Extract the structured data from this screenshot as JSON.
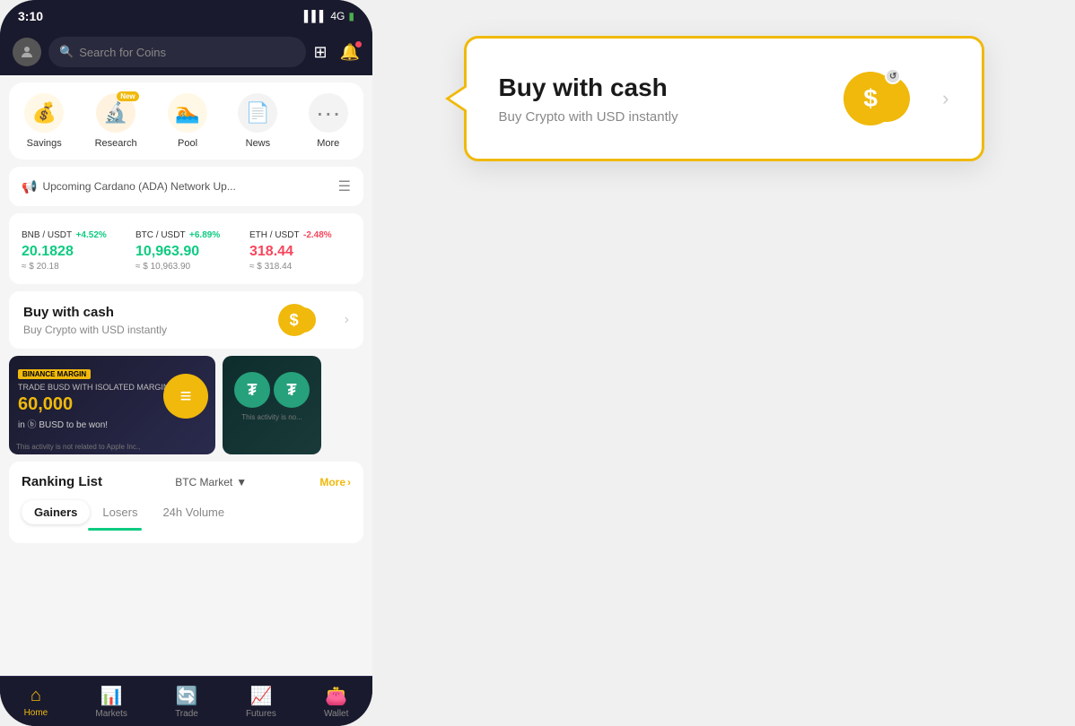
{
  "status_bar": {
    "time": "3:10",
    "signal": "4G"
  },
  "search": {
    "placeholder": "Search for Coins"
  },
  "quick_access": {
    "items": [
      {
        "id": "savings",
        "label": "Savings",
        "icon": "💰",
        "badge": null
      },
      {
        "id": "research",
        "label": "Research",
        "icon": "🔬",
        "badge": "New"
      },
      {
        "id": "pool",
        "label": "Pool",
        "icon": "🏊",
        "badge": null
      },
      {
        "id": "news",
        "label": "News",
        "icon": "📄",
        "badge": null
      },
      {
        "id": "more",
        "label": "More",
        "icon": "⋯",
        "badge": null
      }
    ]
  },
  "announcement": {
    "text": "Upcoming Cardano (ADA) Network Up..."
  },
  "tickers": [
    {
      "pair": "BNB / USDT",
      "change": "+4.52%",
      "positive": true,
      "price": "20.1828",
      "usd": "≈ $ 20.18"
    },
    {
      "pair": "BTC / USDT",
      "change": "+6.89%",
      "positive": true,
      "price": "10,963.90",
      "usd": "≈ $ 10,963.90"
    },
    {
      "pair": "ETH / USDT",
      "change": "-2.48%",
      "positive": false,
      "price": "318.44",
      "usd": "≈ $ 318.44"
    }
  ],
  "buy_cash": {
    "title": "Buy with cash",
    "subtitle": "Buy Crypto with USD instantly"
  },
  "ranking": {
    "title": "Ranking List",
    "filter": "BTC Market",
    "more_label": "More",
    "tabs": [
      "Gainers",
      "Losers",
      "24h Volume"
    ],
    "active_tab": "Gainers"
  },
  "bottom_nav": {
    "items": [
      {
        "id": "home",
        "label": "Home",
        "icon": "🏠",
        "active": true
      },
      {
        "id": "markets",
        "label": "Markets",
        "icon": "📊",
        "active": false
      },
      {
        "id": "trade",
        "label": "Trade",
        "icon": "🔄",
        "active": false
      },
      {
        "id": "futures",
        "label": "Futures",
        "icon": "📈",
        "active": false
      },
      {
        "id": "wallet",
        "label": "Wallet",
        "icon": "👛",
        "active": false
      }
    ]
  },
  "popup": {
    "title": "Buy with cash",
    "subtitle": "Buy Crypto with USD instantly"
  },
  "promo": {
    "binance_margin": "BINANCE MARGIN",
    "trade_text": "TRADE BUSD WITH ISOLATED MARGIN",
    "amount": "60,000",
    "currency": "in ⓑ BUSD to be won!",
    "disclaimer": "This activity is not related to Apple Inc.,"
  }
}
